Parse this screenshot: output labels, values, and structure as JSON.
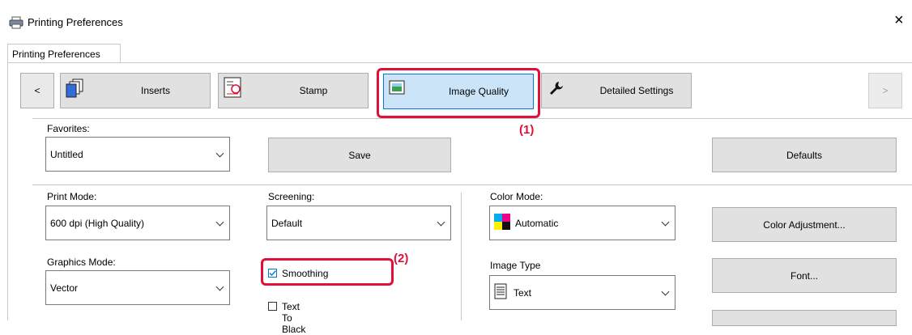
{
  "window": {
    "title": "Printing Preferences",
    "close_glyph": "×"
  },
  "tab": {
    "label": "Printing Preferences"
  },
  "toolbar": {
    "prev": "<",
    "next": ">",
    "inserts": "Inserts",
    "stamp": "Stamp",
    "image_quality": "Image Quality",
    "detailed_settings": "Detailed Settings"
  },
  "favorites": {
    "label": "Favorites:",
    "value": "Untitled",
    "save": "Save",
    "defaults": "Defaults"
  },
  "print_mode": {
    "label": "Print Mode:",
    "value": "600 dpi (High Quality)"
  },
  "screening": {
    "label": "Screening:",
    "value": "Default"
  },
  "color_mode": {
    "label": "Color Mode:",
    "value": "Automatic",
    "color_adjustment": "Color Adjustment..."
  },
  "graphics_mode": {
    "label": "Graphics Mode:",
    "value": "Vector"
  },
  "smoothing": {
    "label": "Smoothing",
    "checked": true
  },
  "text_to_black": {
    "label": "Text To Black",
    "checked": false
  },
  "image_type": {
    "label": "Image Type",
    "value": "Text"
  },
  "font_button": "Font...",
  "callouts": {
    "one": "(1)",
    "two": "(2)"
  },
  "colors": {
    "accent_red": "#e0103a",
    "selected_tab": "#cce4f7",
    "button": "#e1e1e1"
  }
}
